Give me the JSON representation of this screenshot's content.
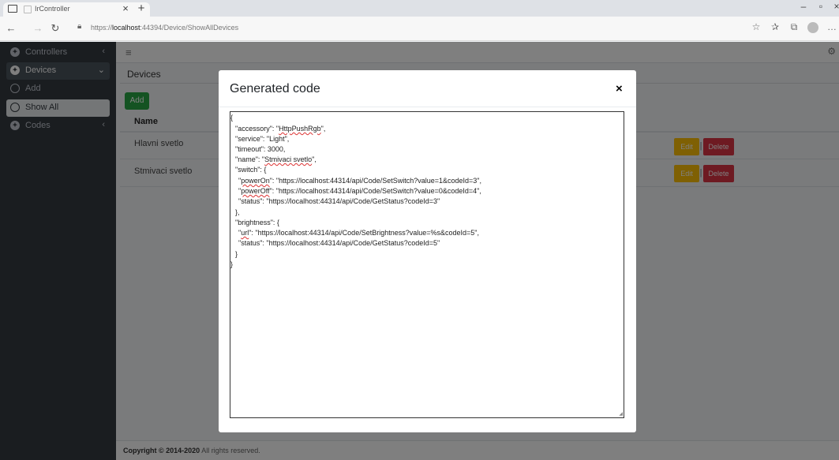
{
  "browser": {
    "tab_title": "IrController",
    "tab_close": "×",
    "new_tab": "+",
    "url_prefix": "https://",
    "url_host": "localhost",
    "url_rest": ":44394/Device/ShowAllDevices",
    "icons": [
      "window-icon",
      "back-icon",
      "forward-icon",
      "refresh-icon",
      "lock-icon",
      "read-aloud-icon",
      "favorites-icon",
      "collections-icon",
      "profile-icon",
      "more-icon",
      "minimize-icon",
      "restore-icon",
      "close-icon"
    ]
  },
  "sidebar": {
    "items": [
      {
        "label": "Controllers",
        "chevron": "‹"
      },
      {
        "label": "Devices",
        "chevron": "⌄"
      },
      {
        "label": "Add"
      },
      {
        "label": "Show All"
      },
      {
        "label": "Codes",
        "chevron": "‹"
      }
    ]
  },
  "navbar": {
    "menu_glyph": "≡",
    "gear_glyph": "⚙"
  },
  "content": {
    "heading": "Devices",
    "add_label": "Add",
    "table": {
      "headers": [
        "Name"
      ],
      "rows": [
        {
          "name": "Hlavni svetlo",
          "edit": "Edit",
          "sep": "|",
          "delete": "Delete"
        },
        {
          "name": "Stmivaci svetlo",
          "edit": "Edit",
          "sep": "|",
          "delete": "Delete"
        }
      ]
    }
  },
  "footer": {
    "copyright": "Copyright © 2014-2020",
    "rights": "All rights reserved."
  },
  "modal": {
    "title": "Generated code",
    "close": "×",
    "code_lines": [
      "{",
      "\"accessory\": \"HttpPushRgb\",",
      "\"service\": \"Light\",",
      "\"timeout\": 3000,",
      "\"name\": \"Stmivaci svetlo\",",
      "\"switch\": {",
      "\"powerOn\": \"https://localhost:44314/api/Code/SetSwitch?value=1&codeId=3\",",
      "\"powerOff\": \"https://localhost:44314/api/Code/SetSwitch?value=0&codeId=4\",",
      "\"status\": \"https://localhost:44314/api/Code/GetStatus?codeId=3\"",
      "},",
      "\"brightness\": {",
      "\"url\": \"https://localhost:44314/api/Code/SetBrightness?value=%s&codeId=5\",",
      "\"status\": \"https://localhost:44314/api/Code/GetStatus?codeId=5\"",
      "}",
      "}"
    ]
  },
  "colors": {
    "sidebar_bg": "#343a40",
    "success": "#28a745",
    "warning": "#ffc107",
    "danger": "#dc3545"
  }
}
